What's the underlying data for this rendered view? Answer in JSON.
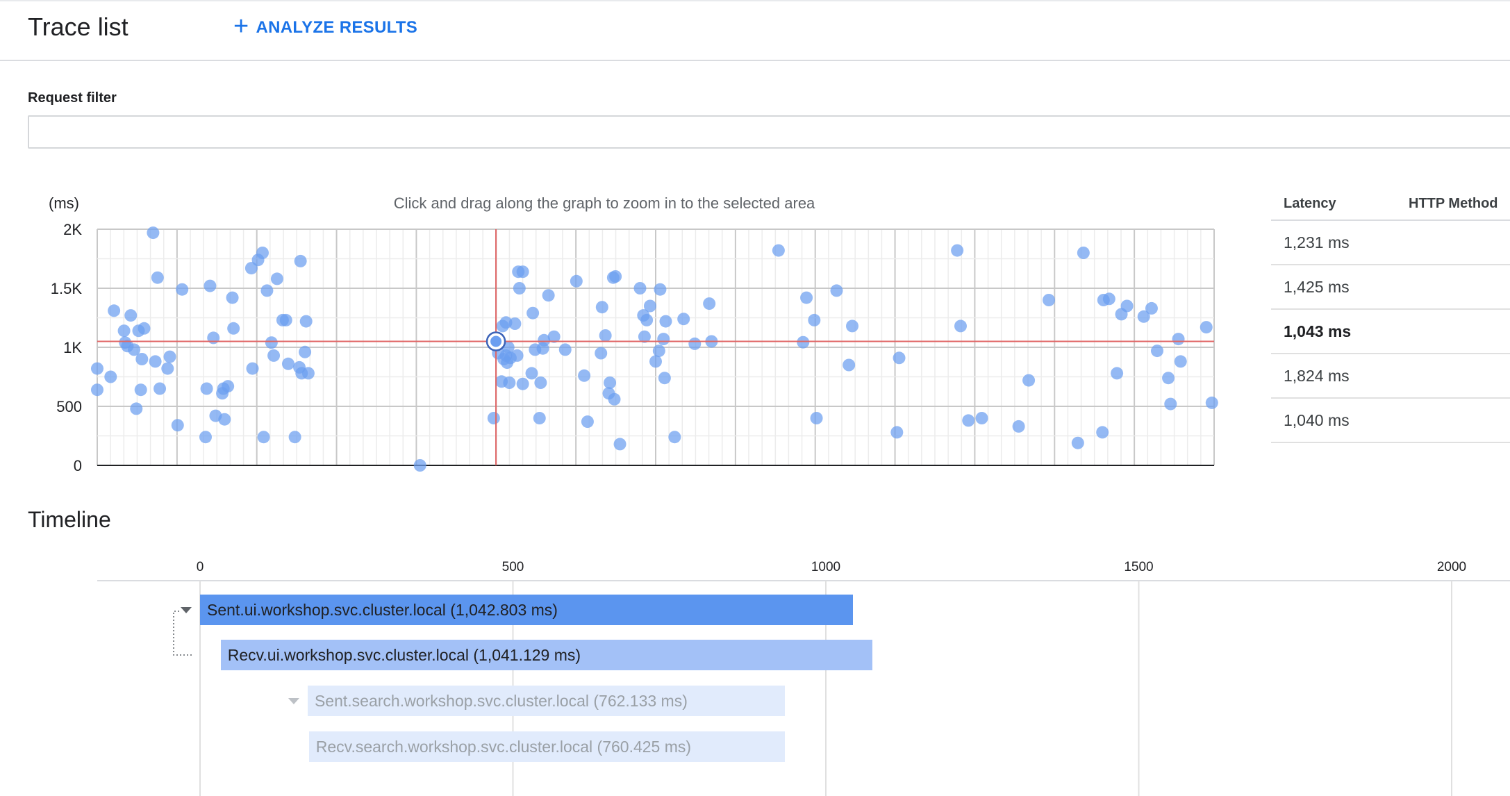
{
  "header": {
    "title": "Trace list",
    "analyze_label": "ANALYZE RESULTS"
  },
  "filter": {
    "label": "Request filter",
    "value": "",
    "placeholder": ""
  },
  "chart_hint": "Click and drag along the graph to zoom in to the selected area",
  "chart_data": {
    "type": "scatter",
    "ylabel": "(ms)",
    "ylim": [
      0,
      2000
    ],
    "y_ticks": [
      "0",
      "500",
      "1K",
      "1.5K",
      "2K"
    ],
    "grid": true,
    "selected_point_index": 54,
    "points": [
      {
        "x": 0.0,
        "y": 640
      },
      {
        "x": 0.0,
        "y": 820
      },
      {
        "x": 0.012,
        "y": 750
      },
      {
        "x": 0.015,
        "y": 1310
      },
      {
        "x": 0.024,
        "y": 1140
      },
      {
        "x": 0.025,
        "y": 1040
      },
      {
        "x": 0.027,
        "y": 1010
      },
      {
        "x": 0.03,
        "y": 1270
      },
      {
        "x": 0.033,
        "y": 980
      },
      {
        "x": 0.035,
        "y": 480
      },
      {
        "x": 0.037,
        "y": 1140
      },
      {
        "x": 0.039,
        "y": 640
      },
      {
        "x": 0.04,
        "y": 900
      },
      {
        "x": 0.042,
        "y": 1160
      },
      {
        "x": 0.05,
        "y": 1970
      },
      {
        "x": 0.052,
        "y": 880
      },
      {
        "x": 0.054,
        "y": 1590
      },
      {
        "x": 0.056,
        "y": 650
      },
      {
        "x": 0.063,
        "y": 820
      },
      {
        "x": 0.065,
        "y": 920
      },
      {
        "x": 0.072,
        "y": 340
      },
      {
        "x": 0.076,
        "y": 1490
      },
      {
        "x": 0.097,
        "y": 240
      },
      {
        "x": 0.098,
        "y": 650
      },
      {
        "x": 0.101,
        "y": 1520
      },
      {
        "x": 0.104,
        "y": 1080
      },
      {
        "x": 0.106,
        "y": 420
      },
      {
        "x": 0.112,
        "y": 610
      },
      {
        "x": 0.113,
        "y": 650
      },
      {
        "x": 0.114,
        "y": 390
      },
      {
        "x": 0.117,
        "y": 670
      },
      {
        "x": 0.121,
        "y": 1420
      },
      {
        "x": 0.122,
        "y": 1160
      },
      {
        "x": 0.138,
        "y": 1670
      },
      {
        "x": 0.139,
        "y": 820
      },
      {
        "x": 0.144,
        "y": 1740
      },
      {
        "x": 0.148,
        "y": 1800
      },
      {
        "x": 0.149,
        "y": 240
      },
      {
        "x": 0.152,
        "y": 1480
      },
      {
        "x": 0.156,
        "y": 1040
      },
      {
        "x": 0.158,
        "y": 930
      },
      {
        "x": 0.161,
        "y": 1580
      },
      {
        "x": 0.166,
        "y": 1230
      },
      {
        "x": 0.169,
        "y": 1230
      },
      {
        "x": 0.171,
        "y": 860
      },
      {
        "x": 0.177,
        "y": 240
      },
      {
        "x": 0.181,
        "y": 830
      },
      {
        "x": 0.182,
        "y": 1730
      },
      {
        "x": 0.183,
        "y": 780
      },
      {
        "x": 0.186,
        "y": 960
      },
      {
        "x": 0.187,
        "y": 1220
      },
      {
        "x": 0.189,
        "y": 780
      },
      {
        "x": 0.289,
        "y": 0
      },
      {
        "x": 0.355,
        "y": 400
      },
      {
        "x": 0.357,
        "y": 1050
      },
      {
        "x": 0.359,
        "y": 950
      },
      {
        "x": 0.362,
        "y": 710
      },
      {
        "x": 0.363,
        "y": 1180
      },
      {
        "x": 0.364,
        "y": 900
      },
      {
        "x": 0.366,
        "y": 1210
      },
      {
        "x": 0.366,
        "y": 930
      },
      {
        "x": 0.367,
        "y": 870
      },
      {
        "x": 0.368,
        "y": 1000
      },
      {
        "x": 0.369,
        "y": 700
      },
      {
        "x": 0.37,
        "y": 910
      },
      {
        "x": 0.374,
        "y": 1200
      },
      {
        "x": 0.376,
        "y": 930
      },
      {
        "x": 0.377,
        "y": 1640
      },
      {
        "x": 0.378,
        "y": 1500
      },
      {
        "x": 0.381,
        "y": 1640
      },
      {
        "x": 0.381,
        "y": 690
      },
      {
        "x": 0.389,
        "y": 780
      },
      {
        "x": 0.39,
        "y": 1290
      },
      {
        "x": 0.392,
        "y": 980
      },
      {
        "x": 0.396,
        "y": 400
      },
      {
        "x": 0.397,
        "y": 700
      },
      {
        "x": 0.399,
        "y": 990
      },
      {
        "x": 0.4,
        "y": 1060
      },
      {
        "x": 0.404,
        "y": 1440
      },
      {
        "x": 0.409,
        "y": 1090
      },
      {
        "x": 0.419,
        "y": 980
      },
      {
        "x": 0.429,
        "y": 1560
      },
      {
        "x": 0.436,
        "y": 760
      },
      {
        "x": 0.439,
        "y": 370
      },
      {
        "x": 0.451,
        "y": 950
      },
      {
        "x": 0.452,
        "y": 1340
      },
      {
        "x": 0.455,
        "y": 1100
      },
      {
        "x": 0.458,
        "y": 610
      },
      {
        "x": 0.459,
        "y": 700
      },
      {
        "x": 0.462,
        "y": 1590
      },
      {
        "x": 0.463,
        "y": 560
      },
      {
        "x": 0.464,
        "y": 1600
      },
      {
        "x": 0.468,
        "y": 180
      },
      {
        "x": 0.486,
        "y": 1500
      },
      {
        "x": 0.489,
        "y": 1270
      },
      {
        "x": 0.49,
        "y": 1090
      },
      {
        "x": 0.492,
        "y": 1230
      },
      {
        "x": 0.495,
        "y": 1350
      },
      {
        "x": 0.5,
        "y": 880
      },
      {
        "x": 0.503,
        "y": 970
      },
      {
        "x": 0.504,
        "y": 1490
      },
      {
        "x": 0.507,
        "y": 1070
      },
      {
        "x": 0.508,
        "y": 740
      },
      {
        "x": 0.509,
        "y": 1220
      },
      {
        "x": 0.517,
        "y": 240
      },
      {
        "x": 0.525,
        "y": 1240
      },
      {
        "x": 0.535,
        "y": 1030
      },
      {
        "x": 0.548,
        "y": 1370
      },
      {
        "x": 0.55,
        "y": 1050
      },
      {
        "x": 0.61,
        "y": 1820
      },
      {
        "x": 0.632,
        "y": 1043
      },
      {
        "x": 0.635,
        "y": 1420
      },
      {
        "x": 0.642,
        "y": 1230
      },
      {
        "x": 0.644,
        "y": 400
      },
      {
        "x": 0.662,
        "y": 1480
      },
      {
        "x": 0.673,
        "y": 850
      },
      {
        "x": 0.676,
        "y": 1180
      },
      {
        "x": 0.716,
        "y": 280
      },
      {
        "x": 0.718,
        "y": 910
      },
      {
        "x": 0.77,
        "y": 1820
      },
      {
        "x": 0.773,
        "y": 1180
      },
      {
        "x": 0.78,
        "y": 380
      },
      {
        "x": 0.792,
        "y": 400
      },
      {
        "x": 0.825,
        "y": 330
      },
      {
        "x": 0.834,
        "y": 720
      },
      {
        "x": 0.852,
        "y": 1400
      },
      {
        "x": 0.878,
        "y": 190
      },
      {
        "x": 0.883,
        "y": 1800
      },
      {
        "x": 0.9,
        "y": 280
      },
      {
        "x": 0.901,
        "y": 1400
      },
      {
        "x": 0.906,
        "y": 1410
      },
      {
        "x": 0.913,
        "y": 780
      },
      {
        "x": 0.917,
        "y": 1280
      },
      {
        "x": 0.922,
        "y": 1350
      },
      {
        "x": 0.937,
        "y": 1260
      },
      {
        "x": 0.944,
        "y": 1330
      },
      {
        "x": 0.949,
        "y": 970
      },
      {
        "x": 0.959,
        "y": 740
      },
      {
        "x": 0.961,
        "y": 520
      },
      {
        "x": 0.968,
        "y": 1070
      },
      {
        "x": 0.97,
        "y": 880
      },
      {
        "x": 0.993,
        "y": 1170
      },
      {
        "x": 0.998,
        "y": 530
      }
    ]
  },
  "trace_table": {
    "headers": [
      "Latency",
      "HTTP Method"
    ],
    "rows": [
      "1,231 ms",
      "1,425 ms",
      "1,043 ms",
      "1,824 ms",
      "1,040 ms"
    ],
    "selected_row": 2
  },
  "timeline": {
    "title": "Timeline",
    "axis_ticks": [
      "0",
      "500",
      "1000",
      "1500",
      "2000"
    ],
    "axis_max": 2000,
    "spans": [
      {
        "label": "Sent.ui.workshop.svc.cluster.local (1,042.803 ms)",
        "start_ms": 0,
        "duration_ms": 1042.803,
        "depth": 0,
        "collapsible": true
      },
      {
        "label": "Recv.ui.workshop.svc.cluster.local (1,041.129 ms)",
        "start_ms": 33,
        "duration_ms": 1041.129,
        "depth": 1,
        "collapsible": false
      },
      {
        "label": "Sent.search.workshop.svc.cluster.local (762.133 ms)",
        "start_ms": 172,
        "duration_ms": 762.133,
        "depth": 2,
        "collapsible": true
      },
      {
        "label": "Recv.search.workshop.svc.cluster.local (760.425 ms)",
        "start_ms": 174,
        "duration_ms": 760.425,
        "depth": 3,
        "collapsible": false
      }
    ],
    "colors": [
      "#5b95ef",
      "#a3c1f7",
      "#e1ebfc",
      "#e1ebfc"
    ],
    "text_colors": [
      "#202124",
      "#202124",
      "#9aa0a6",
      "#9aa0a6"
    ]
  }
}
